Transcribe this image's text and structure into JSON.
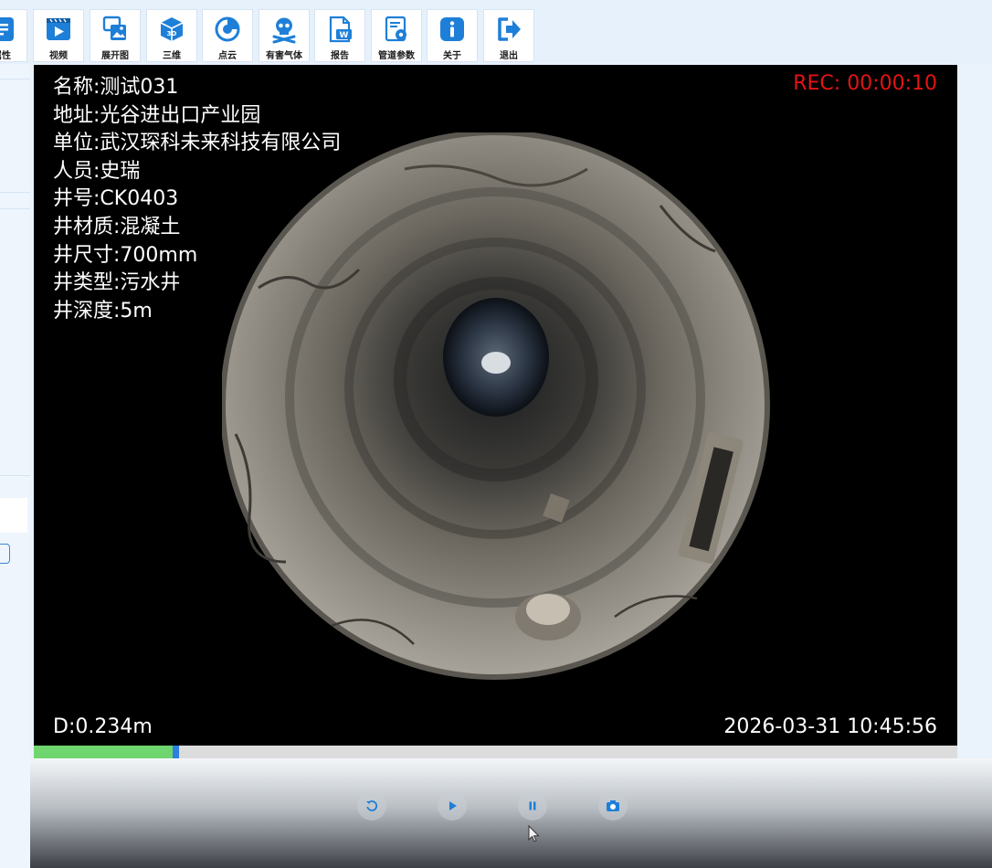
{
  "toolbar": {
    "items": [
      {
        "label": "属性",
        "icon": "list-icon"
      },
      {
        "label": "视频",
        "icon": "video-icon"
      },
      {
        "label": "展开图",
        "icon": "unfold-image-icon"
      },
      {
        "label": "三维",
        "icon": "3d-cube-icon"
      },
      {
        "label": "点云",
        "icon": "point-cloud-icon"
      },
      {
        "label": "有害气体",
        "icon": "skull-icon"
      },
      {
        "label": "报告",
        "icon": "word-report-icon"
      },
      {
        "label": "管道参数",
        "icon": "settings-doc-icon"
      },
      {
        "label": "关于",
        "icon": "info-icon"
      },
      {
        "label": "退出",
        "icon": "exit-icon"
      }
    ]
  },
  "video": {
    "info": {
      "name": "名称:测试031",
      "address": "地址:光谷进出口产业园",
      "company": "单位:武汉琛科未来科技有限公司",
      "person": "人员:史瑞",
      "well_no": "井号:CK0403",
      "material": "井材质:混凝土",
      "size": "井尺寸:700mm",
      "type": "井类型:污水井",
      "depth": "井深度:5m"
    },
    "rec": "REC: 00:00:10",
    "distance": "D:0.234m",
    "datetime": "2026-03-31 10:45:56"
  },
  "playback": {
    "progress_fraction": 0.15
  },
  "colors": {
    "accent": "#1e7fd8",
    "rec": "#e31414",
    "progress_fill": "#6fd56e",
    "progress_knob": "#2d80e0",
    "toolbar_bg": "#e6f1fc"
  }
}
